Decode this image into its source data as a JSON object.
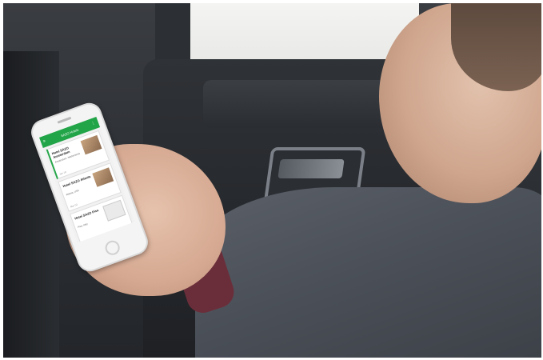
{
  "app": {
    "title": "SAZO Hotels"
  },
  "hotels": [
    {
      "name": "Hotel SAZO Amsterdam",
      "detail": "Amsterdam, Netherlands",
      "status": "Jan 18"
    },
    {
      "name": "Hotel SAZO Atlanta",
      "detail": "Atlanta, USA",
      "status": "Mar 02"
    },
    {
      "name": "Hotel SAZO Pisa",
      "detail": "Pisa, Italy",
      "status": ""
    }
  ],
  "icons": {
    "menu": "menu-icon",
    "overflow": "more-icon"
  },
  "colors": {
    "accent": "#22a448"
  }
}
